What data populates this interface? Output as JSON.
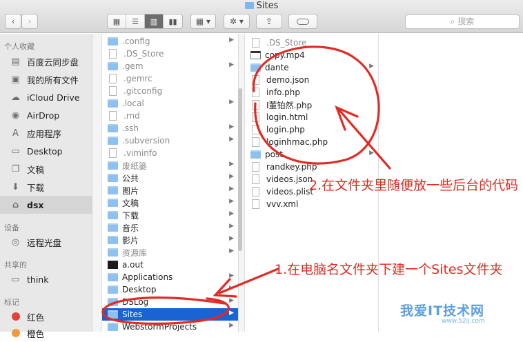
{
  "window": {
    "title": "Sites"
  },
  "toolbar": {
    "back": "‹",
    "forward": "›",
    "search_placeholder": "搜索"
  },
  "sidebar": {
    "favorites_header": "个人收藏",
    "favorites": [
      {
        "label": "百度云同步盘",
        "icon": "cloud-sync-icon"
      },
      {
        "label": "我的所有文件",
        "icon": "all-files-icon"
      },
      {
        "label": "iCloud Drive",
        "icon": "icloud-icon"
      },
      {
        "label": "AirDrop",
        "icon": "airdrop-icon"
      },
      {
        "label": "应用程序",
        "icon": "applications-icon"
      },
      {
        "label": "Desktop",
        "icon": "desktop-icon"
      },
      {
        "label": "文稿",
        "icon": "documents-icon"
      },
      {
        "label": "下载",
        "icon": "downloads-icon"
      },
      {
        "label": "dsx",
        "icon": "home-icon"
      }
    ],
    "devices_header": "设备",
    "devices": [
      {
        "label": "远程光盘",
        "icon": "disc-icon"
      }
    ],
    "shared_header": "共享的",
    "shared": [
      {
        "label": "think",
        "icon": "computer-icon"
      }
    ],
    "tags_header": "标记",
    "tags": [
      {
        "label": "红色",
        "color": "#e63f35"
      },
      {
        "label": "橙色",
        "color": "#f29a38"
      }
    ]
  },
  "column2": [
    {
      "name": ".config",
      "kind": "folder",
      "arrow": true,
      "dim": true
    },
    {
      "name": ".DS_Store",
      "kind": "file",
      "arrow": false,
      "dim": true
    },
    {
      "name": ".gem",
      "kind": "folder",
      "arrow": true,
      "dim": true
    },
    {
      "name": ".gemrc",
      "kind": "file",
      "arrow": false,
      "dim": true
    },
    {
      "name": ".gitconfig",
      "kind": "file",
      "arrow": false,
      "dim": true
    },
    {
      "name": ".local",
      "kind": "folder",
      "arrow": true,
      "dim": true
    },
    {
      "name": ".rnd",
      "kind": "file",
      "arrow": false,
      "dim": true
    },
    {
      "name": ".ssh",
      "kind": "folder",
      "arrow": true,
      "dim": true
    },
    {
      "name": ".subversion",
      "kind": "folder",
      "arrow": true,
      "dim": true
    },
    {
      "name": ".viminfo",
      "kind": "file",
      "arrow": false,
      "dim": true
    },
    {
      "name": "废纸篓",
      "kind": "folder",
      "arrow": true,
      "dim": true
    },
    {
      "name": "公共",
      "kind": "folder",
      "arrow": true,
      "dim": false
    },
    {
      "name": "图片",
      "kind": "folder",
      "arrow": true,
      "dim": false
    },
    {
      "name": "文稿",
      "kind": "folder",
      "arrow": true,
      "dim": false
    },
    {
      "name": "下载",
      "kind": "folder",
      "arrow": true,
      "dim": false
    },
    {
      "name": "音乐",
      "kind": "folder",
      "arrow": true,
      "dim": false
    },
    {
      "name": "影片",
      "kind": "folder",
      "arrow": true,
      "dim": false
    },
    {
      "name": "资源库",
      "kind": "folder",
      "arrow": true,
      "dim": true
    },
    {
      "name": "a.out",
      "kind": "term",
      "arrow": false,
      "dim": false
    },
    {
      "name": "Applications",
      "kind": "folder",
      "arrow": true,
      "dim": false
    },
    {
      "name": "Desktop",
      "kind": "folder",
      "arrow": true,
      "dim": false
    },
    {
      "name": "DSLog",
      "kind": "folder",
      "arrow": true,
      "dim": false
    },
    {
      "name": "Sites",
      "kind": "folder",
      "arrow": true,
      "dim": false,
      "selected": true
    },
    {
      "name": "WebstormProjects",
      "kind": "folder",
      "arrow": true,
      "dim": false
    }
  ],
  "column3": [
    {
      "name": ".DS_Store",
      "kind": "file",
      "arrow": false,
      "dim": true
    },
    {
      "name": "copy.mp4",
      "kind": "video",
      "arrow": false,
      "dim": false
    },
    {
      "name": "dante",
      "kind": "folder",
      "arrow": true,
      "dim": false
    },
    {
      "name": "demo.json",
      "kind": "file",
      "arrow": false,
      "dim": false
    },
    {
      "name": "info.php",
      "kind": "file",
      "arrow": false,
      "dim": false
    },
    {
      "name": "I董铂然.php",
      "kind": "file",
      "arrow": false,
      "dim": false
    },
    {
      "name": "login.html",
      "kind": "file",
      "arrow": false,
      "dim": false
    },
    {
      "name": "login.php",
      "kind": "file",
      "arrow": false,
      "dim": false
    },
    {
      "name": "loginhmac.php",
      "kind": "file",
      "arrow": false,
      "dim": false
    },
    {
      "name": "post",
      "kind": "folder",
      "arrow": true,
      "dim": false
    },
    {
      "name": "randkey.php",
      "kind": "file",
      "arrow": false,
      "dim": false
    },
    {
      "name": "videos.json",
      "kind": "file",
      "arrow": false,
      "dim": false
    },
    {
      "name": "videos.plist",
      "kind": "file",
      "arrow": false,
      "dim": false
    },
    {
      "name": "vvv.xml",
      "kind": "file",
      "arrow": false,
      "dim": false
    }
  ],
  "annotations": {
    "note1": "1.在电脑名文件夹下建一个Sites文件夹",
    "note2": "2.在文件夹里随便放一些后台的代码",
    "color": "#e12a23"
  },
  "watermark": {
    "text": "我爱IT技术网",
    "url": "www.52ij.com"
  }
}
